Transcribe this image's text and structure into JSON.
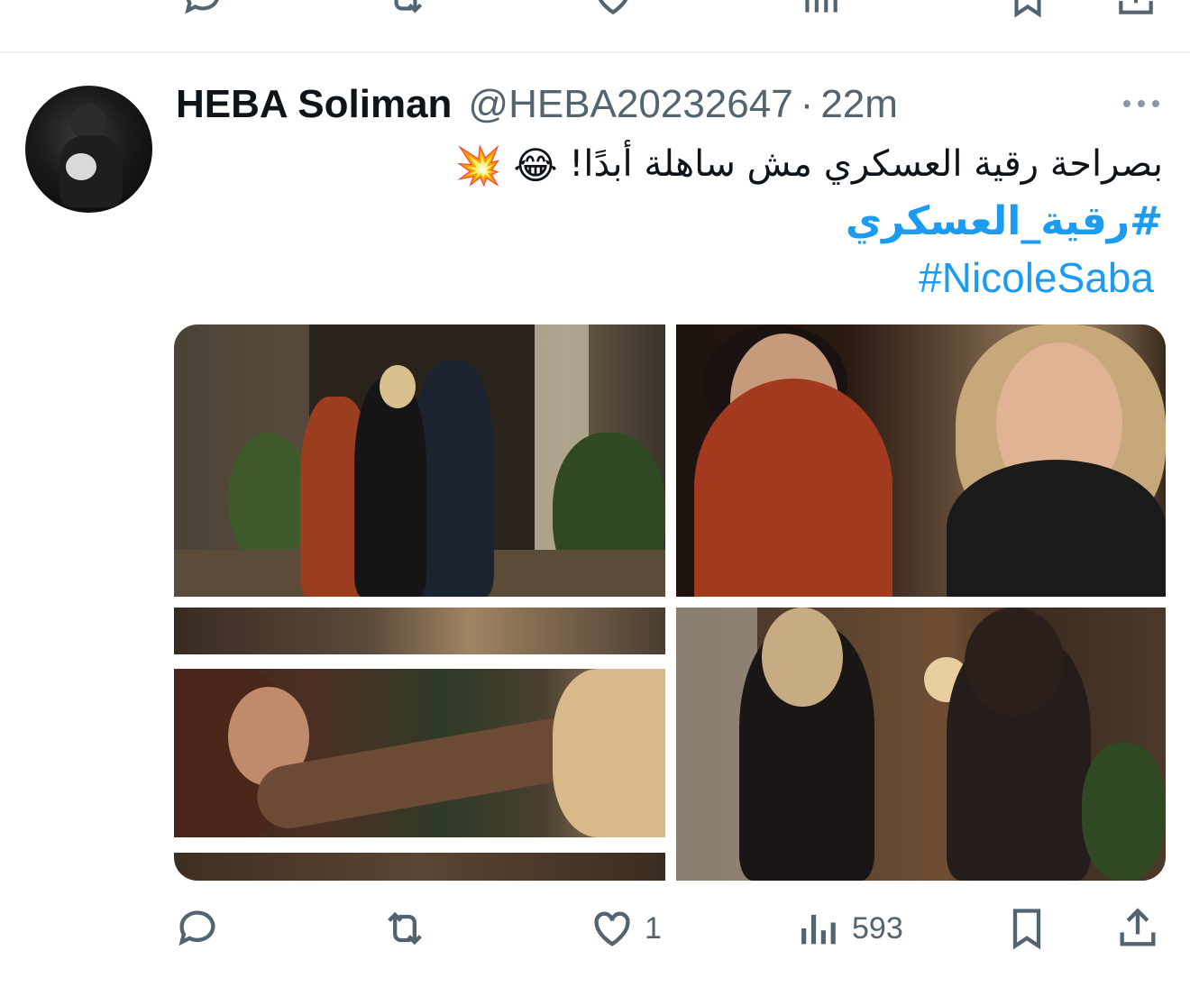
{
  "previous_tweet": {
    "actions": [
      "reply",
      "retweet",
      "like",
      "views",
      "bookmark",
      "share"
    ]
  },
  "tweet": {
    "author_name": "HEBA Soliman",
    "handle": "@HEBA20232647",
    "separator": "·",
    "time": "22m",
    "text": "بصراحة رقية العسكري مش ساهلة أبدًا!",
    "emojis": [
      "😂",
      "💥"
    ],
    "hashtags": [
      "#رقية_العسكري",
      "#NicoleSaba"
    ],
    "media_count": 4,
    "actions": {
      "reply_count": "",
      "retweet_count": "",
      "like_count": "1",
      "views_count": "593"
    }
  },
  "colors": {
    "text": "#0f1419",
    "secondary": "#536471",
    "link": "#1d9bf0",
    "divider": "#eff3f4"
  },
  "icons": {
    "reply": "speech-bubble-icon",
    "retweet": "retweet-arrows-icon",
    "like": "heart-icon",
    "views": "bar-chart-icon",
    "bookmark": "bookmark-icon",
    "share": "share-upload-icon",
    "more": "ellipsis-icon"
  }
}
